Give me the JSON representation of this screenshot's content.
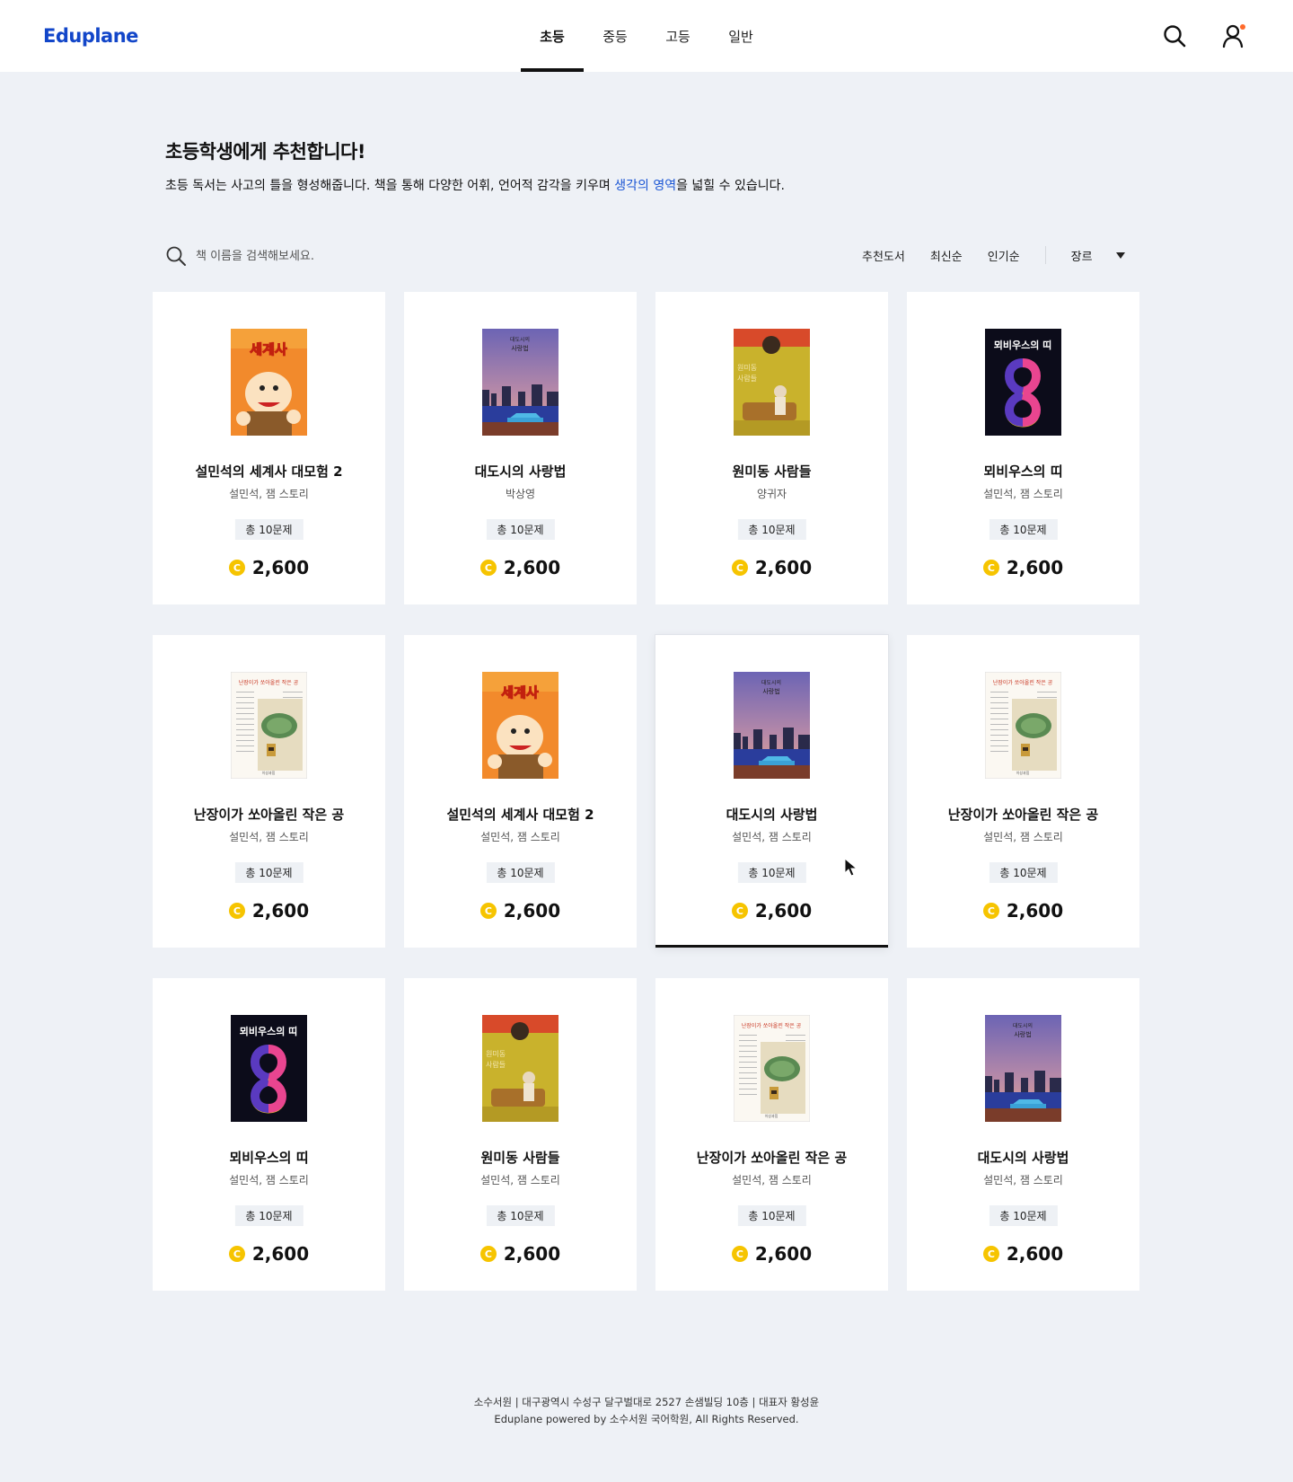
{
  "header": {
    "logo": "Eduplane",
    "tabs": [
      {
        "label": "초등",
        "active": true
      },
      {
        "label": "중등",
        "active": false
      },
      {
        "label": "고등",
        "active": false
      },
      {
        "label": "일반",
        "active": false
      }
    ],
    "icons": [
      "search-icon",
      "user-icon"
    ],
    "notification_dot_color": "#ff6a2b"
  },
  "intro": {
    "title": "초등학생에게 추천합니다!",
    "desc_before": "초등 독서는 사고의 틀을 형성해줍니다. 책을 통해 다양한 어휘, 언어적 감각을 키우며 ",
    "desc_highlight": "생각의 영역",
    "desc_after": "을 넓힐  수 있습니다."
  },
  "toolbar": {
    "search_placeholder": "책 이름을 검색해보세요.",
    "sorts": [
      "추천도서",
      "최신순",
      "인기순"
    ],
    "genre_label": "장르"
  },
  "books": [
    {
      "title": "설민석의 세계사 대모험 2",
      "author": "설민석, 잼 스토리",
      "questions": "총 10문제",
      "price": "2,600",
      "cover": "history"
    },
    {
      "title": "대도시의 사랑법",
      "author": "박상영",
      "questions": "총 10문제",
      "price": "2,600",
      "cover": "city"
    },
    {
      "title": "원미동 사람들",
      "author": "양귀자",
      "questions": "총 10문제",
      "price": "2,600",
      "cover": "wonmi"
    },
    {
      "title": "뫼비우스의 띠",
      "author": "설민석, 잼 스토리",
      "questions": "총 10문제",
      "price": "2,600",
      "cover": "mobius"
    },
    {
      "title": "난장이가 쏘아올린 작은 공",
      "author": "설민석, 잼 스토리",
      "questions": "총 10문제",
      "price": "2,600",
      "cover": "ball"
    },
    {
      "title": "설민석의 세계사 대모험 2",
      "author": "설민석, 잼 스토리",
      "questions": "총 10문제",
      "price": "2,600",
      "cover": "history"
    },
    {
      "title": "대도시의 사랑법",
      "author": "설민석, 잼 스토리",
      "questions": "총 10문제",
      "price": "2,600",
      "cover": "city",
      "hovered": true
    },
    {
      "title": "난장이가 쏘아올린 작은 공",
      "author": "설민석, 잼 스토리",
      "questions": "총 10문제",
      "price": "2,600",
      "cover": "ball"
    },
    {
      "title": "뫼비우스의 띠",
      "author": "설민석, 잼 스토리",
      "questions": "총 10문제",
      "price": "2,600",
      "cover": "mobius"
    },
    {
      "title": "원미동 사람들",
      "author": "설민석, 잼 스토리",
      "questions": "총 10문제",
      "price": "2,600",
      "cover": "wonmi"
    },
    {
      "title": "난장이가 쏘아올린 작은 공",
      "author": "설민석, 잼 스토리",
      "questions": "총 10문제",
      "price": "2,600",
      "cover": "ball"
    },
    {
      "title": "대도시의 사랑법",
      "author": "설민석, 잼 스토리",
      "questions": "총 10문제",
      "price": "2,600",
      "cover": "city"
    }
  ],
  "coin_symbol": "C",
  "coin_color": "#f6c400",
  "accent_color": "#1246c9",
  "footer": {
    "line1": "소수서원 | 대구광역시 수성구 달구벌대로 2527 손샘빌딩 10층 | 대표자 황성윤",
    "line2": "Eduplane powered by 소수서원 국어학원, All Rights Reserved."
  }
}
